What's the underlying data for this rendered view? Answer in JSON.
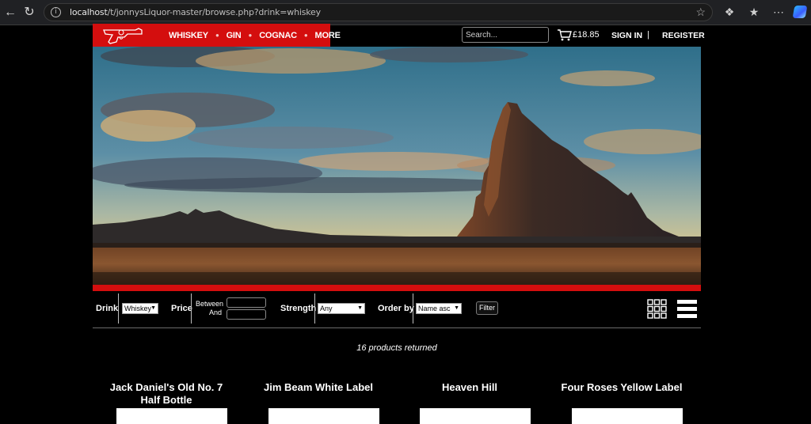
{
  "browser": {
    "url_host": "localhost",
    "url_path": "/t/jonnysLiquor-master/browse.php?drink=whiskey"
  },
  "header": {
    "nav": [
      "WHISKEY",
      "GIN",
      "COGNAC",
      "MORE"
    ],
    "search_placeholder": "Search...",
    "cart_total": "£18.85",
    "signin": "SIGN IN",
    "separator": "|",
    "register": "REGISTER",
    "accent_color": "#d40e0e"
  },
  "filters": {
    "drink_label": "Drink",
    "drink_value": "Whiskey",
    "price_label": "Price",
    "between_label": "Between",
    "and_label": "And",
    "strength_label": "Strength",
    "strength_value": "Any",
    "order_label": "Order by",
    "order_value": "Name asc",
    "filter_button": "Filter"
  },
  "results": {
    "count_text": "16 products returned"
  },
  "products": [
    {
      "name": "Jack Daniel's Old No. 7 Half Bottle"
    },
    {
      "name": "Jim Beam White Label"
    },
    {
      "name": "Heaven Hill"
    },
    {
      "name": "Four Roses Yellow Label"
    }
  ]
}
